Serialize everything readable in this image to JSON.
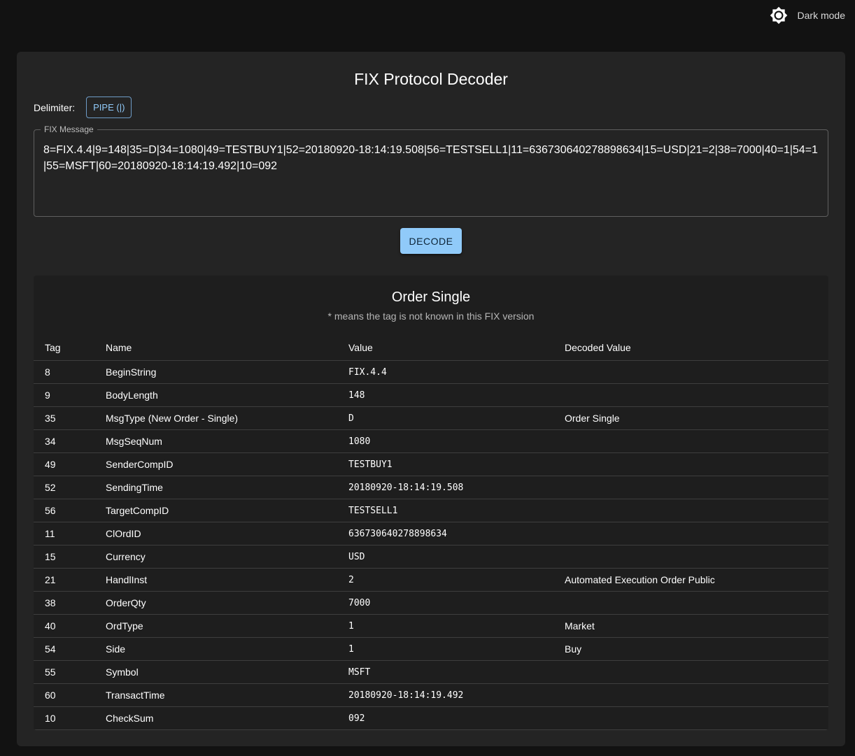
{
  "header": {
    "dark_mode_label": "Dark mode",
    "theme_icon": "brightness-icon"
  },
  "decoder": {
    "title": "FIX Protocol Decoder",
    "delimiter_label": "Delimiter:",
    "delimiter_button": "PIPE (|)",
    "field_label": "FIX Message",
    "field_value": "8=FIX.4.4|9=148|35=D|34=1080|49=TESTBUY1|52=20180920-18:14:19.508|56=TESTSELL1|11=636730640278898634|15=USD|21=2|38=7000|40=1|54=1|55=MSFT|60=20180920-18:14:19.492|10=092",
    "decode_button": "DECODE"
  },
  "result": {
    "title": "Order Single",
    "note": "* means the tag is not known in this FIX version",
    "columns": [
      "Tag",
      "Name",
      "Value",
      "Decoded Value"
    ],
    "rows": [
      [
        "8",
        "BeginString",
        "FIX.4.4",
        ""
      ],
      [
        "9",
        "BodyLength",
        "148",
        ""
      ],
      [
        "35",
        "MsgType (New Order - Single)",
        "D",
        "Order Single"
      ],
      [
        "34",
        "MsgSeqNum",
        "1080",
        ""
      ],
      [
        "49",
        "SenderCompID",
        "TESTBUY1",
        ""
      ],
      [
        "52",
        "SendingTime",
        "20180920-18:14:19.508",
        ""
      ],
      [
        "56",
        "TargetCompID",
        "TESTSELL1",
        ""
      ],
      [
        "11",
        "ClOrdID",
        "636730640278898634",
        ""
      ],
      [
        "15",
        "Currency",
        "USD",
        ""
      ],
      [
        "21",
        "HandlInst",
        "2",
        "Automated Execution Order Public"
      ],
      [
        "38",
        "OrderQty",
        "7000",
        ""
      ],
      [
        "40",
        "OrdType",
        "1",
        "Market"
      ],
      [
        "54",
        "Side",
        "1",
        "Buy"
      ],
      [
        "55",
        "Symbol",
        "MSFT",
        ""
      ],
      [
        "60",
        "TransactTime",
        "20180920-18:14:19.492",
        ""
      ],
      [
        "10",
        "CheckSum",
        "092",
        ""
      ]
    ]
  }
}
